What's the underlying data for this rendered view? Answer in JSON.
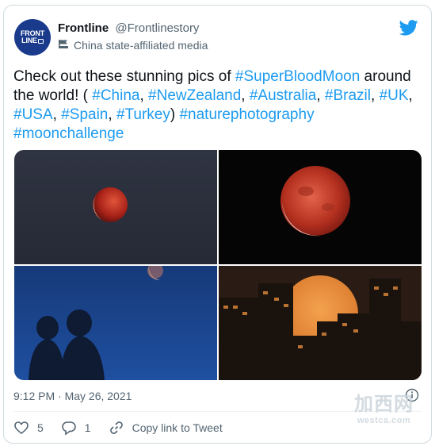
{
  "author": {
    "name": "Frontline",
    "handle": "@Frontlinestory",
    "affiliation": "China state-affiliated media",
    "avatar_text_top": "FRONT",
    "avatar_text_bottom": "LINE"
  },
  "tweet": {
    "segments": [
      {
        "text": "Check out these stunning pics of ",
        "tag": false
      },
      {
        "text": "#SuperBloodMoon",
        "tag": true
      },
      {
        "text": " around the world!  ( ",
        "tag": false
      },
      {
        "text": "#China",
        "tag": true
      },
      {
        "text": ", ",
        "tag": false
      },
      {
        "text": "#NewZealand",
        "tag": true
      },
      {
        "text": ", ",
        "tag": false
      },
      {
        "text": "#Australia",
        "tag": true
      },
      {
        "text": ", ",
        "tag": false
      },
      {
        "text": "#Brazil",
        "tag": true
      },
      {
        "text": ", ",
        "tag": false
      },
      {
        "text": "#UK",
        "tag": true
      },
      {
        "text": ", ",
        "tag": false
      },
      {
        "text": "#USA",
        "tag": true
      },
      {
        "text": ", ",
        "tag": false
      },
      {
        "text": "#Spain",
        "tag": true
      },
      {
        "text": ", ",
        "tag": false
      },
      {
        "text": "#Turkey",
        "tag": true
      },
      {
        "text": ") ",
        "tag": false
      },
      {
        "text": "#naturephotography",
        "tag": true
      },
      {
        "text": " ",
        "tag": false
      },
      {
        "text": "#moonchallenge",
        "tag": true
      }
    ]
  },
  "meta": {
    "timestamp": "9:12 PM · May 26, 2021"
  },
  "actions": {
    "likes": "5",
    "replies": "1",
    "copy_link": "Copy link to Tweet"
  },
  "watermark": {
    "main": "加西网",
    "sub": "westca.com"
  },
  "colors": {
    "link": "#1d9bf0",
    "secondary_text": "#536471",
    "avatar_bg": "#1a3a8c"
  },
  "icons": {
    "brand": "twitter-bird-icon",
    "affiliation": "state-media-flag-icon",
    "info": "info-circle-icon",
    "like": "heart-icon",
    "reply": "reply-bubble-icon",
    "copy_link": "link-icon"
  }
}
